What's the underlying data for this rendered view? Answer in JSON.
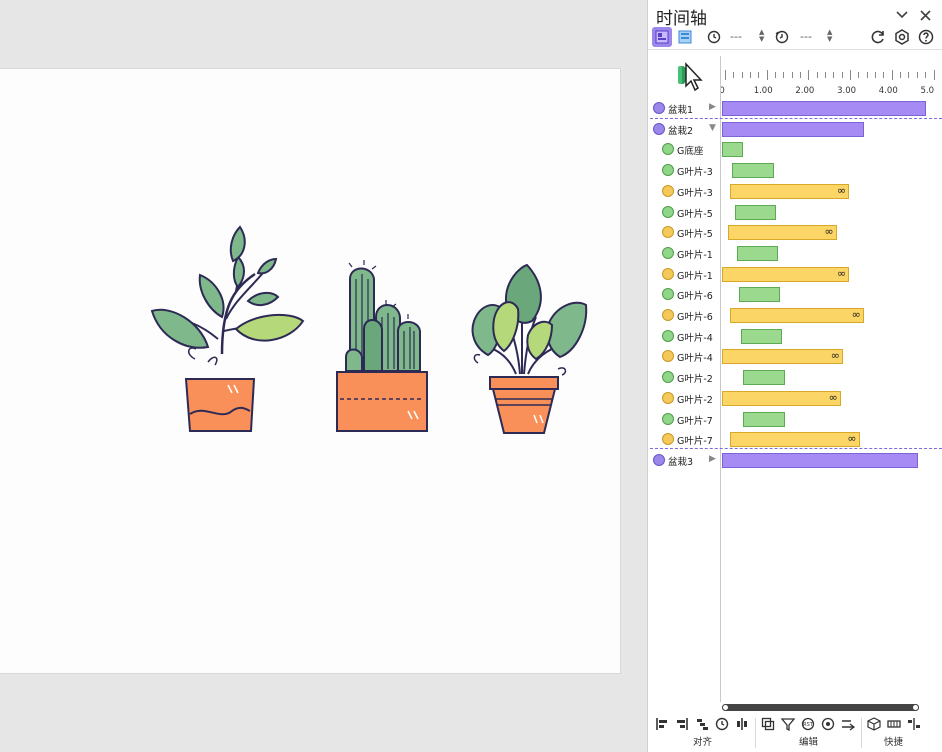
{
  "panel": {
    "title": "时间轴",
    "toolbar": {
      "time1": "---",
      "time2": "---"
    },
    "ruler": {
      "labels": [
        "00",
        "1.00",
        "2.00",
        "3.00",
        "4.00",
        "5.0"
      ]
    },
    "rows": [
      {
        "label": "盆栽1",
        "kind": "group",
        "expanded": false,
        "dot": "#9b86ea",
        "bar_color": "#a78bf5",
        "bar_border": "#7b63d8",
        "start": 0.0,
        "end": 4.9,
        "infinite": false
      },
      {
        "label": "盆栽2",
        "kind": "group",
        "expanded": true,
        "dot": "#9b86ea",
        "bar_color": "#a78bf5",
        "bar_border": "#7b63d8",
        "start": 0.0,
        "end": 3.4,
        "infinite": false
      },
      {
        "label": "G底座",
        "kind": "enter",
        "dot": "#8fd68a",
        "bar_color": "#9bd98f",
        "bar_border": "#5cab52",
        "start": 0.0,
        "end": 0.5,
        "infinite": false
      },
      {
        "label": "G叶片-3",
        "kind": "enter",
        "dot": "#8fd68a",
        "bar_color": "#9bd98f",
        "bar_border": "#5cab52",
        "start": 0.25,
        "end": 1.25,
        "infinite": false
      },
      {
        "label": "G叶片-3",
        "kind": "emphasis",
        "dot": "#f5c85c",
        "bar_color": "#fbd565",
        "bar_border": "#d8a828",
        "start": 0.2,
        "end": 3.05,
        "infinite": true
      },
      {
        "label": "G叶片-5",
        "kind": "enter",
        "dot": "#8fd68a",
        "bar_color": "#9bd98f",
        "bar_border": "#5cab52",
        "start": 0.3,
        "end": 1.3,
        "infinite": false
      },
      {
        "label": "G叶片-5",
        "kind": "emphasis",
        "dot": "#f5c85c",
        "bar_color": "#fbd565",
        "bar_border": "#d8a828",
        "start": 0.15,
        "end": 2.75,
        "infinite": true
      },
      {
        "label": "G叶片-1",
        "kind": "enter",
        "dot": "#8fd68a",
        "bar_color": "#9bd98f",
        "bar_border": "#5cab52",
        "start": 0.35,
        "end": 1.35,
        "infinite": false
      },
      {
        "label": "G叶片-1",
        "kind": "emphasis",
        "dot": "#f5c85c",
        "bar_color": "#fbd565",
        "bar_border": "#d8a828",
        "start": 0.0,
        "end": 3.05,
        "infinite": true
      },
      {
        "label": "G叶片-6",
        "kind": "enter",
        "dot": "#8fd68a",
        "bar_color": "#9bd98f",
        "bar_border": "#5cab52",
        "start": 0.4,
        "end": 1.4,
        "infinite": false
      },
      {
        "label": "G叶片-6",
        "kind": "emphasis",
        "dot": "#f5c85c",
        "bar_color": "#fbd565",
        "bar_border": "#d8a828",
        "start": 0.2,
        "end": 3.4,
        "infinite": true
      },
      {
        "label": "G叶片-4",
        "kind": "enter",
        "dot": "#8fd68a",
        "bar_color": "#9bd98f",
        "bar_border": "#5cab52",
        "start": 0.45,
        "end": 1.45,
        "infinite": false
      },
      {
        "label": "G叶片-4",
        "kind": "emphasis",
        "dot": "#f5c85c",
        "bar_color": "#fbd565",
        "bar_border": "#d8a828",
        "start": 0.0,
        "end": 2.9,
        "infinite": true
      },
      {
        "label": "G叶片-2",
        "kind": "enter",
        "dot": "#8fd68a",
        "bar_color": "#9bd98f",
        "bar_border": "#5cab52",
        "start": 0.5,
        "end": 1.5,
        "infinite": false
      },
      {
        "label": "G叶片-2",
        "kind": "emphasis",
        "dot": "#f5c85c",
        "bar_color": "#fbd565",
        "bar_border": "#d8a828",
        "start": 0.0,
        "end": 2.85,
        "infinite": true
      },
      {
        "label": "G叶片-7",
        "kind": "enter",
        "dot": "#8fd68a",
        "bar_color": "#9bd98f",
        "bar_border": "#5cab52",
        "start": 0.5,
        "end": 1.5,
        "infinite": false
      },
      {
        "label": "G叶片-7",
        "kind": "emphasis",
        "dot": "#f5c85c",
        "bar_color": "#fbd565",
        "bar_border": "#d8a828",
        "start": 0.2,
        "end": 3.3,
        "infinite": true
      },
      {
        "label": "盆栽3",
        "kind": "group",
        "expanded": false,
        "dot": "#9b86ea",
        "bar_color": "#a78bf5",
        "bar_border": "#7b63d8",
        "start": 0.0,
        "end": 4.7,
        "infinite": false
      }
    ],
    "infinity_symbol": "∞",
    "bottom_groups": {
      "align": "对齐",
      "edit": "编辑",
      "quick": "快捷"
    }
  }
}
